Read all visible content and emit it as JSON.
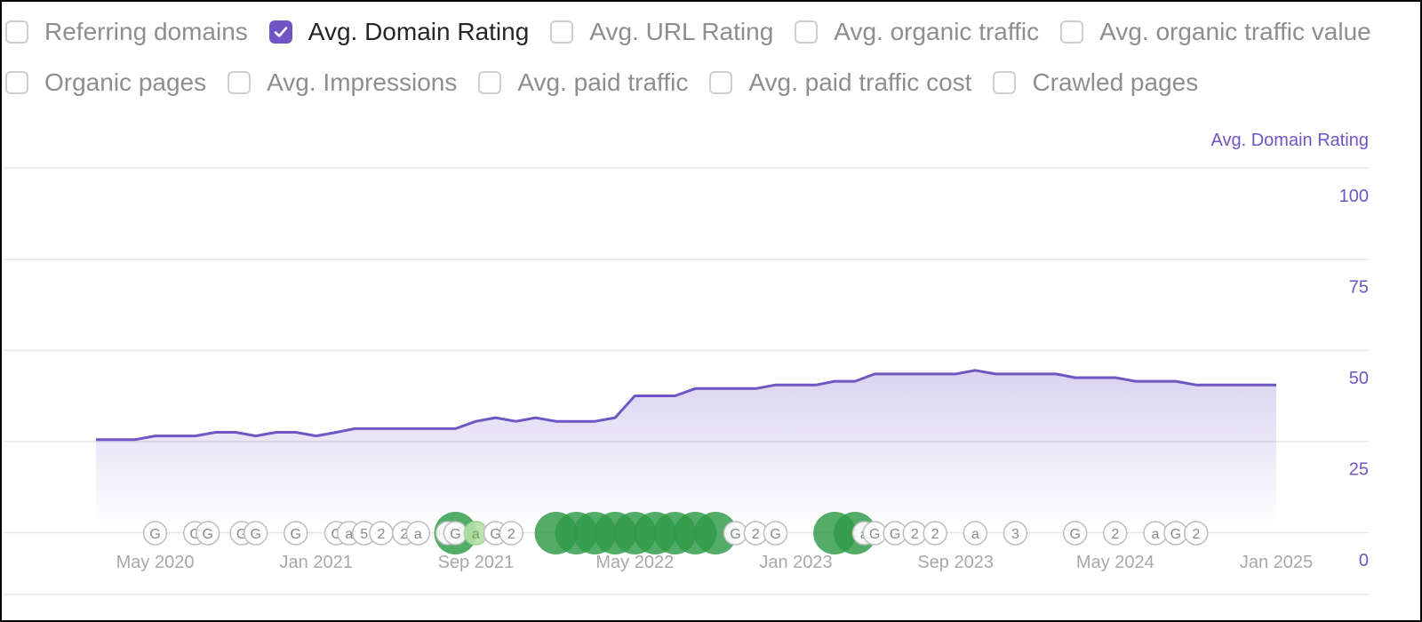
{
  "checkboxes": {
    "row1": [
      {
        "label": "Referring domains",
        "checked": false
      },
      {
        "label": "Avg. Domain Rating",
        "checked": true
      },
      {
        "label": "Avg. URL Rating",
        "checked": false
      },
      {
        "label": "Avg. organic traffic",
        "checked": false
      },
      {
        "label": "Avg. organic traffic value",
        "checked": false
      }
    ],
    "row2": [
      {
        "label": "Organic pages",
        "checked": false
      },
      {
        "label": "Avg. Impressions",
        "checked": false
      },
      {
        "label": "Avg. paid traffic",
        "checked": false
      },
      {
        "label": "Avg. paid traffic cost",
        "checked": false
      },
      {
        "label": "Crawled pages",
        "checked": false
      }
    ]
  },
  "colors": {
    "accent": "#6e56c4",
    "line": "#6e56c4",
    "gridline": "#e6e6e6",
    "tick_text": "#a8a8a8",
    "marker_green": "#2e9a48",
    "marker_light_green": "#b6e0a8"
  },
  "chart_data": {
    "type": "area",
    "y_axis_title": "Avg. Domain Rating",
    "y_ticks": [
      "100",
      "75",
      "50",
      "25",
      "0"
    ],
    "ylim": [
      0,
      100
    ],
    "xlim": [
      "2020-01-01",
      "2025-03-01"
    ],
    "x_ticks": [
      "May 2020",
      "Jan 2021",
      "Sep 2021",
      "May 2022",
      "Jan 2023",
      "Sep 2023",
      "May 2024",
      "Jan 2025"
    ],
    "grid": true,
    "series": [
      {
        "name": "Avg. Domain Rating",
        "x": [
          "2020-02-01",
          "2020-03-01",
          "2020-04-01",
          "2020-05-01",
          "2020-06-01",
          "2020-07-01",
          "2020-08-01",
          "2020-09-01",
          "2020-10-01",
          "2020-11-01",
          "2020-12-01",
          "2021-01-01",
          "2021-02-01",
          "2021-03-01",
          "2021-04-01",
          "2021-05-01",
          "2021-06-01",
          "2021-07-01",
          "2021-08-01",
          "2021-09-01",
          "2021-10-01",
          "2021-11-01",
          "2021-12-01",
          "2022-01-01",
          "2022-02-01",
          "2022-03-01",
          "2022-04-01",
          "2022-05-01",
          "2022-06-01",
          "2022-07-01",
          "2022-08-01",
          "2022-09-01",
          "2022-10-01",
          "2022-11-01",
          "2022-12-01",
          "2023-01-01",
          "2023-02-01",
          "2023-03-01",
          "2023-04-01",
          "2023-05-01",
          "2023-06-01",
          "2023-07-01",
          "2023-08-01",
          "2023-09-01",
          "2023-10-01",
          "2023-11-01",
          "2023-12-01",
          "2024-01-01",
          "2024-02-01",
          "2024-03-01",
          "2024-04-01",
          "2024-05-01",
          "2024-06-01",
          "2024-07-01",
          "2024-08-01",
          "2024-09-01",
          "2024-10-01",
          "2024-11-01",
          "2024-12-01",
          "2025-01-01"
        ],
        "values": [
          33,
          33,
          33,
          34,
          34,
          34,
          35,
          35,
          34,
          35,
          35,
          34,
          35,
          36,
          36,
          36,
          36,
          36,
          36,
          38,
          39,
          38,
          39,
          38,
          38,
          38,
          39,
          45,
          45,
          45,
          47,
          47,
          47,
          47,
          48,
          48,
          48,
          49,
          49,
          51,
          51,
          51,
          51,
          51,
          52,
          51,
          51,
          51,
          51,
          50,
          50,
          50,
          49,
          49,
          49,
          48,
          48,
          48,
          48,
          48
        ]
      }
    ],
    "markers": [
      {
        "date": "2020-05-01",
        "label": "G",
        "kind": "outline"
      },
      {
        "date": "2020-07-01",
        "label": "G",
        "kind": "outline"
      },
      {
        "date": "2020-07-20",
        "label": "G",
        "kind": "outline"
      },
      {
        "date": "2020-09-10",
        "label": "G",
        "kind": "outline"
      },
      {
        "date": "2020-10-01",
        "label": "G",
        "kind": "outline"
      },
      {
        "date": "2020-12-01",
        "label": "G",
        "kind": "outline"
      },
      {
        "date": "2021-02-01",
        "label": "G",
        "kind": "outline"
      },
      {
        "date": "2021-02-20",
        "label": "a",
        "kind": "outline"
      },
      {
        "date": "2021-03-15",
        "label": "5",
        "kind": "outline"
      },
      {
        "date": "2021-04-10",
        "label": "2",
        "kind": "outline"
      },
      {
        "date": "2021-05-15",
        "label": "2",
        "kind": "outline"
      },
      {
        "date": "2021-06-05",
        "label": "a",
        "kind": "outline"
      },
      {
        "date": "2021-07-20",
        "label": "3",
        "kind": "outline"
      },
      {
        "date": "2021-08-01",
        "label": "",
        "kind": "big_green"
      },
      {
        "date": "2021-08-01",
        "label": "G",
        "kind": "outline"
      },
      {
        "date": "2021-09-01",
        "label": "a",
        "kind": "light_green"
      },
      {
        "date": "2021-10-01",
        "label": "G",
        "kind": "outline"
      },
      {
        "date": "2021-10-25",
        "label": "2",
        "kind": "outline"
      },
      {
        "date": "2022-01-01",
        "label": "",
        "kind": "big_green"
      },
      {
        "date": "2022-02-01",
        "label": "",
        "kind": "big_green"
      },
      {
        "date": "2022-03-01",
        "label": "",
        "kind": "big_green"
      },
      {
        "date": "2022-04-01",
        "label": "",
        "kind": "big_green"
      },
      {
        "date": "2022-05-01",
        "label": "",
        "kind": "big_green"
      },
      {
        "date": "2022-06-01",
        "label": "",
        "kind": "big_green"
      },
      {
        "date": "2022-07-01",
        "label": "",
        "kind": "big_green"
      },
      {
        "date": "2022-08-01",
        "label": "",
        "kind": "big_green"
      },
      {
        "date": "2022-09-01",
        "label": "",
        "kind": "big_green"
      },
      {
        "date": "2022-10-01",
        "label": "G",
        "kind": "outline"
      },
      {
        "date": "2022-11-01",
        "label": "2",
        "kind": "outline"
      },
      {
        "date": "2022-12-01",
        "label": "G",
        "kind": "outline"
      },
      {
        "date": "2023-03-01",
        "label": "",
        "kind": "big_green"
      },
      {
        "date": "2023-04-01",
        "label": "",
        "kind": "big_green"
      },
      {
        "date": "2023-04-15",
        "label": "a",
        "kind": "outline"
      },
      {
        "date": "2023-05-01",
        "label": "G",
        "kind": "outline"
      },
      {
        "date": "2023-06-01",
        "label": "G",
        "kind": "outline"
      },
      {
        "date": "2023-07-01",
        "label": "2",
        "kind": "outline"
      },
      {
        "date": "2023-08-01",
        "label": "2",
        "kind": "outline"
      },
      {
        "date": "2023-10-01",
        "label": "a",
        "kind": "outline"
      },
      {
        "date": "2023-12-01",
        "label": "3",
        "kind": "outline"
      },
      {
        "date": "2024-03-01",
        "label": "G",
        "kind": "outline"
      },
      {
        "date": "2024-05-01",
        "label": "2",
        "kind": "outline"
      },
      {
        "date": "2024-07-01",
        "label": "a",
        "kind": "outline"
      },
      {
        "date": "2024-08-01",
        "label": "G",
        "kind": "outline"
      },
      {
        "date": "2024-09-01",
        "label": "2",
        "kind": "outline"
      }
    ]
  }
}
